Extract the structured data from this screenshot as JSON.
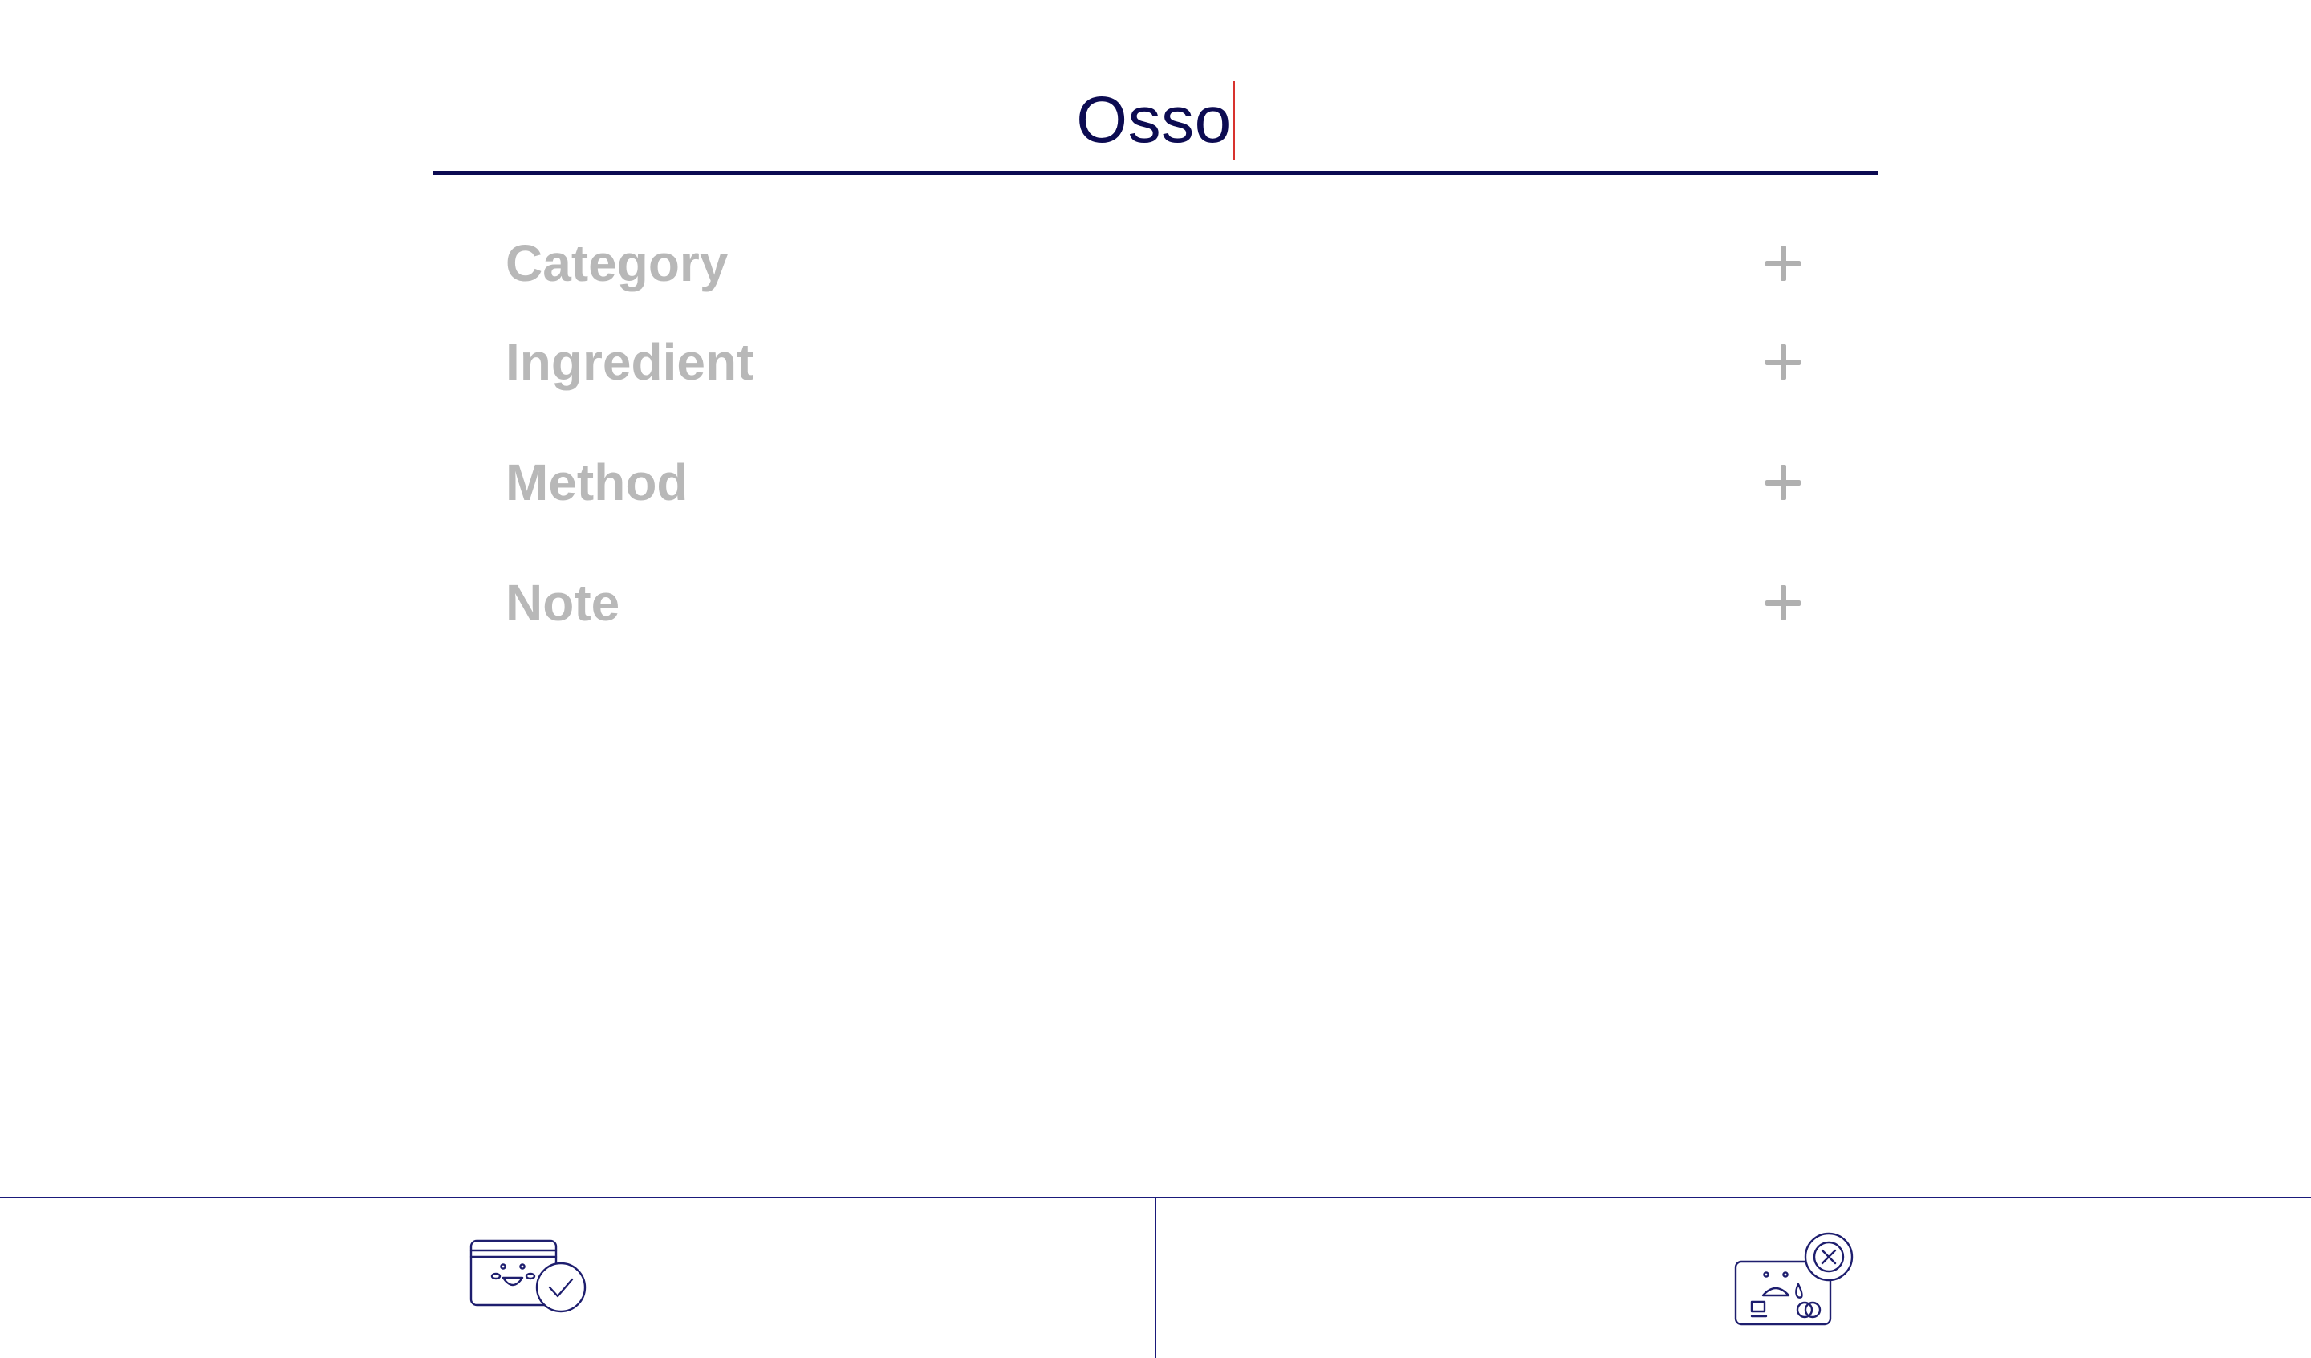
{
  "recipe": {
    "title_value": "Osso"
  },
  "sections": [
    {
      "label": "Category",
      "icon": "plus-icon"
    },
    {
      "label": "Ingredient",
      "icon": "plus-icon"
    },
    {
      "label": "Method",
      "icon": "plus-icon"
    },
    {
      "label": "Note",
      "icon": "plus-icon"
    }
  ],
  "footer": {
    "save_icon": "happy-card-check-icon",
    "discard_icon": "sad-card-cross-icon"
  },
  "colors": {
    "accent": "#0c0b52",
    "caret": "#d8322e",
    "muted": "#b8b8b8"
  }
}
